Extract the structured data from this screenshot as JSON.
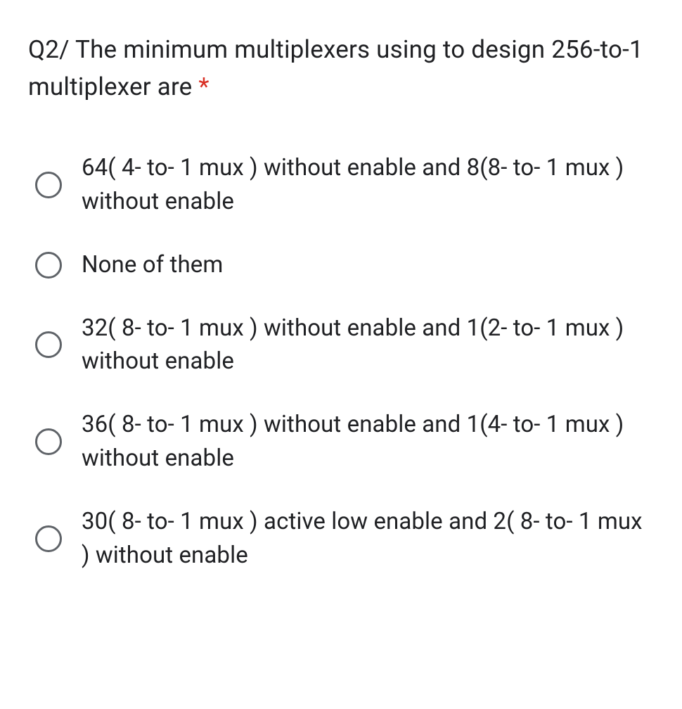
{
  "question": {
    "text": "Q2/ The minimum multiplexers using to design 256-to-1 multiplexer are ",
    "required_marker": "*"
  },
  "options": [
    {
      "label": "64( 4- to- 1 mux ) without enable and 8(8- to- 1 mux ) without enable"
    },
    {
      "label": "None of them"
    },
    {
      "label": "32( 8- to- 1 mux ) without enable and 1(2- to- 1 mux ) without enable"
    },
    {
      "label": "36( 8- to- 1 mux ) without enable and 1(4- to- 1 mux ) without enable"
    },
    {
      "label": "30( 8- to- 1 mux ) active low enable and 2( 8- to- 1 mux ) without enable"
    }
  ]
}
